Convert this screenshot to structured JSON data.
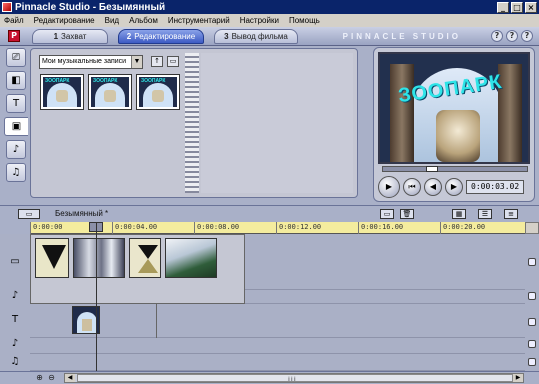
{
  "window": {
    "title": "Pinnacle Studio - Безымянный",
    "min": "_",
    "max": "□",
    "close": "×"
  },
  "menu": [
    "Файл",
    "Редактирование",
    "Вид",
    "Альбом",
    "Инструментарий",
    "Настройки",
    "Помощь"
  ],
  "tabs": [
    {
      "num": "1",
      "label": "Захват"
    },
    {
      "num": "2",
      "label": "Редактирование",
      "active": true
    },
    {
      "num": "3",
      "label": "Вывод фильма"
    }
  ],
  "brand": "PINNACLE STUDIO",
  "help_icons": [
    "?",
    "?",
    "?"
  ],
  "left_tools": [
    {
      "name": "video-scenes-icon",
      "glyph": "⎚"
    },
    {
      "name": "transitions-icon",
      "glyph": "◧"
    },
    {
      "name": "titles-icon",
      "glyph": "T"
    },
    {
      "name": "photos-icon",
      "glyph": "▣"
    },
    {
      "name": "sound-effects-icon",
      "glyph": "♪"
    },
    {
      "name": "music-icon",
      "glyph": "♫"
    }
  ],
  "album": {
    "select_value": "Мои музыкальные записи",
    "thumb_word": "ЗООПАРК",
    "thumb_count": 3
  },
  "preview": {
    "title_text": "ЗООПАРК",
    "timecode": "0:00:03.02",
    "scrub_position": 0.32
  },
  "timeline": {
    "project_name": "Безымянный *",
    "ticks": [
      "0:00:00",
      "0:00:04.00",
      "0:00:08.00",
      "0:00:12.00",
      "0:00:16.00",
      "0:00:20.00"
    ]
  },
  "colors": {
    "ruler": "#f4ec9e",
    "title_text": "#2ee4e8",
    "active_tab": "#3d5bc4"
  }
}
